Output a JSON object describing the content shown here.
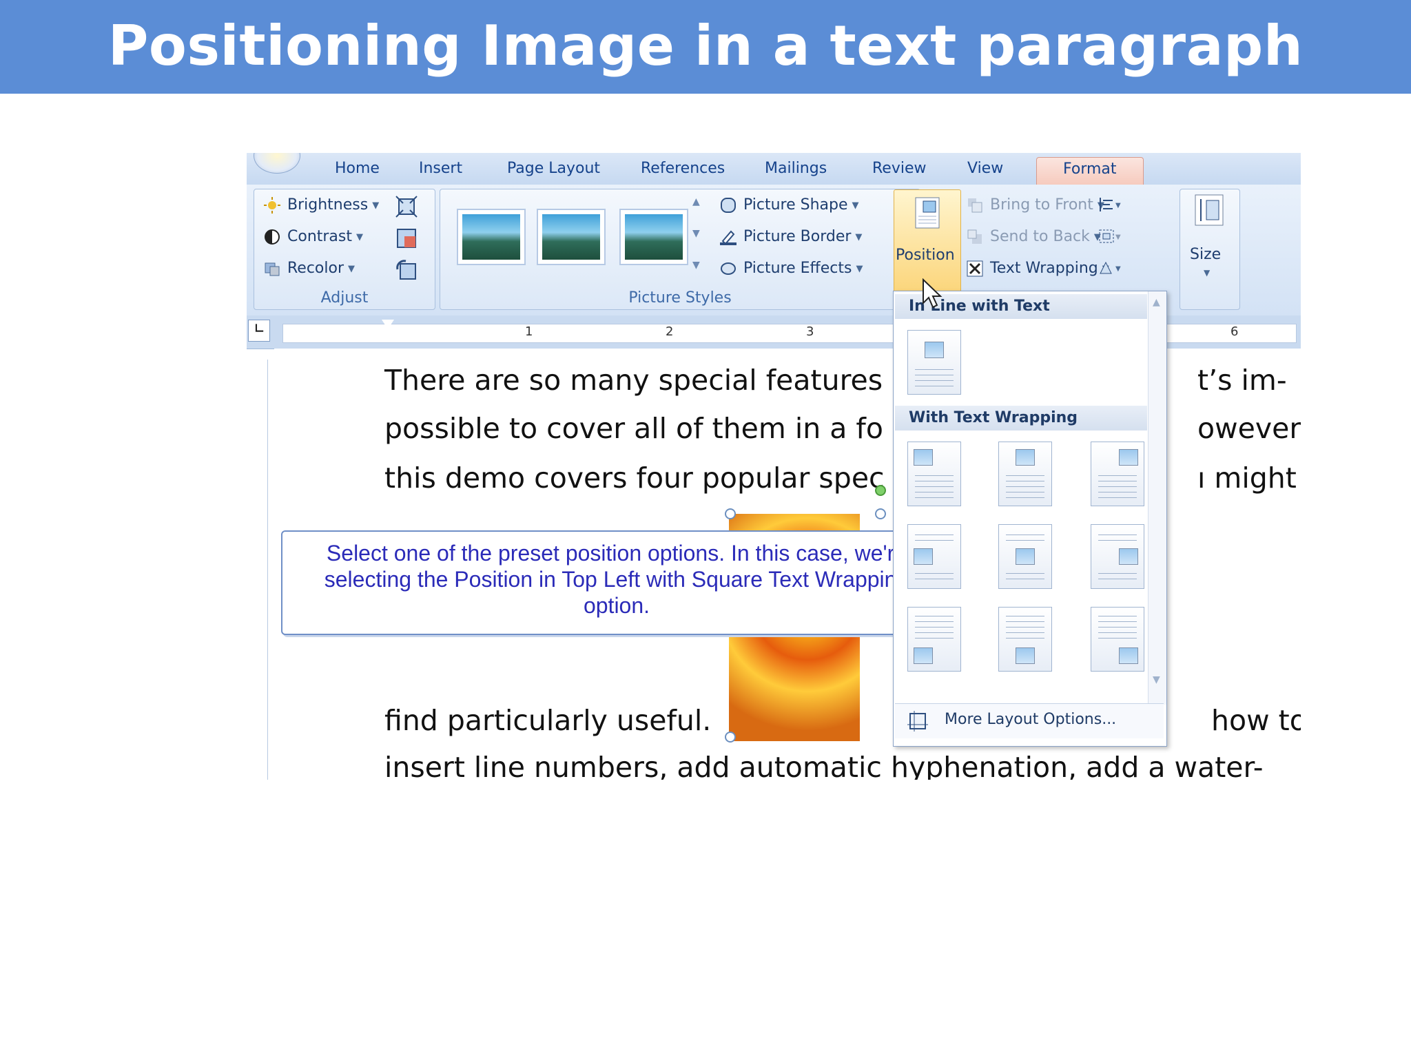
{
  "slide": {
    "title": "Positioning Image in a text paragraph"
  },
  "ribbon": {
    "tabs": [
      "Home",
      "Insert",
      "Page Layout",
      "References",
      "Mailings",
      "Review",
      "View",
      "Format"
    ],
    "active_tab": "Format",
    "adjust": {
      "label": "Adjust",
      "brightness": "Brightness",
      "contrast": "Contrast",
      "recolor": "Recolor"
    },
    "picture_styles": {
      "label": "Picture Styles",
      "shape": "Picture Shape",
      "border": "Picture Border",
      "effects": "Picture Effects"
    },
    "arrange": {
      "position": "Position",
      "bring_to_front": "Bring to Front",
      "send_to_back": "Send to Back",
      "text_wrapping": "Text Wrapping"
    },
    "size": {
      "label": "Size"
    }
  },
  "ruler": {
    "numbers": [
      "1",
      "2",
      "3",
      "6"
    ]
  },
  "document": {
    "lines_left": [
      "There are so many special features",
      "possible to cover all of them in a fo",
      "this demo covers four popular spec",
      "find particularly useful.",
      "insert line numbers, add automatic hyphenation, add a water-"
    ],
    "lines_right": [
      "t’s im-",
      "owever,",
      "ı might",
      "how to"
    ]
  },
  "callout": {
    "text": "Select one of the preset position options. In this case, we're selecting the Position in Top Left with Square Text Wrapping option."
  },
  "position_menu": {
    "inline_header": "In Line with Text",
    "wrapping_header": "With Text Wrapping",
    "more_options": "More Layout Options..."
  }
}
